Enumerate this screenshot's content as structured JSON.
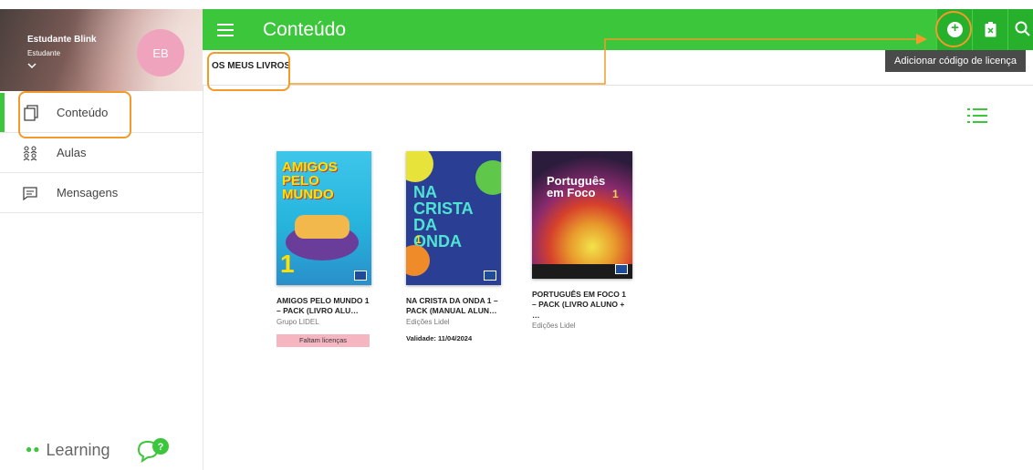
{
  "profile": {
    "name": "Estudante Blink",
    "role": "Estudante",
    "initials": "EB"
  },
  "sidebar": {
    "items": [
      {
        "label": "Conteúdo",
        "icon": "book-copy-icon",
        "active": true
      },
      {
        "label": "Aulas",
        "icon": "people-group-icon"
      },
      {
        "label": "Mensagens",
        "icon": "message-icon"
      }
    ],
    "brand": "Learning",
    "help_icon": "help-chat-icon"
  },
  "header": {
    "title": "Conteúdo",
    "add_icon": "add-circle-icon",
    "redeem_icon": "voucher-icon",
    "search_icon": "search-icon"
  },
  "tabs": [
    {
      "label": "OS MEUS LIVROS"
    }
  ],
  "tooltip": "Adicionar código de licença",
  "view_toggle_icon": "list-view-icon",
  "books": [
    {
      "cover_title": "AMIGOS PELO MUNDO",
      "cover_number": "1",
      "title": "AMIGOS PELO MUNDO 1 – PACK (LIVRO ALU…",
      "publisher": "Grupo LIDEL",
      "status": "Faltam licenças"
    },
    {
      "cover_title": "NA CRISTA DA ONDA",
      "cover_number": "1",
      "title": "NA CRISTA DA ONDA 1 – PACK (MANUAL ALUN…",
      "publisher": "Edições Lidel",
      "validity": "Validade: 11/04/2024"
    },
    {
      "cover_title": "Português em Foco",
      "cover_number": "1",
      "title": "PORTUGUÊS EM FOCO 1 – PACK (LIVRO ALUNO + …",
      "publisher": "Edições Lidel"
    }
  ],
  "colors": {
    "primary": "#3cc63c",
    "primary_dark": "#27b02b",
    "highlight": "#f39a2b",
    "avatar": "#f0a3bd",
    "badge": "#f5b6c2"
  }
}
